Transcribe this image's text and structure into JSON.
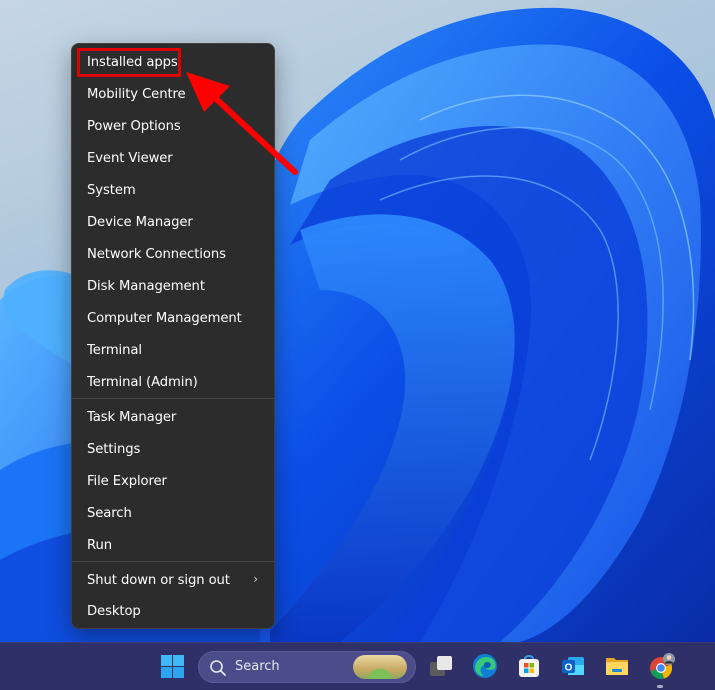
{
  "context_menu": {
    "items": [
      {
        "label": "Installed apps",
        "highlighted": true
      },
      {
        "label": "Mobility Centre"
      },
      {
        "label": "Power Options"
      },
      {
        "label": "Event Viewer"
      },
      {
        "label": "System"
      },
      {
        "label": "Device Manager"
      },
      {
        "label": "Network Connections"
      },
      {
        "label": "Disk Management"
      },
      {
        "label": "Computer Management"
      },
      {
        "label": "Terminal"
      },
      {
        "label": "Terminal (Admin)"
      },
      {
        "label": "Task Manager"
      },
      {
        "label": "Settings"
      },
      {
        "label": "File Explorer"
      },
      {
        "label": "Search"
      },
      {
        "label": "Run"
      },
      {
        "label": "Shut down or sign out",
        "submenu": true,
        "chevron": "›"
      },
      {
        "label": "Desktop"
      }
    ]
  },
  "annotation": {
    "highlight_color": "#e00000",
    "target": "Installed apps"
  },
  "taskbar": {
    "start_icon": "windows-logo-icon",
    "search": {
      "placeholder": "Search",
      "icon": "search-icon"
    },
    "apps": [
      {
        "name": "task-view",
        "icon": "task-view-icon"
      },
      {
        "name": "Microsoft Edge",
        "icon": "edge-icon"
      },
      {
        "name": "Microsoft Store",
        "icon": "store-icon"
      },
      {
        "name": "Outlook",
        "icon": "outlook-icon"
      },
      {
        "name": "File Explorer",
        "icon": "file-explorer-icon"
      },
      {
        "name": "Google Chrome",
        "icon": "chrome-icon",
        "running": true
      }
    ]
  },
  "colors": {
    "menu_bg": "#2c2c2c",
    "taskbar_bg": "#2f3068",
    "accent_blue": "#1a5cff"
  }
}
